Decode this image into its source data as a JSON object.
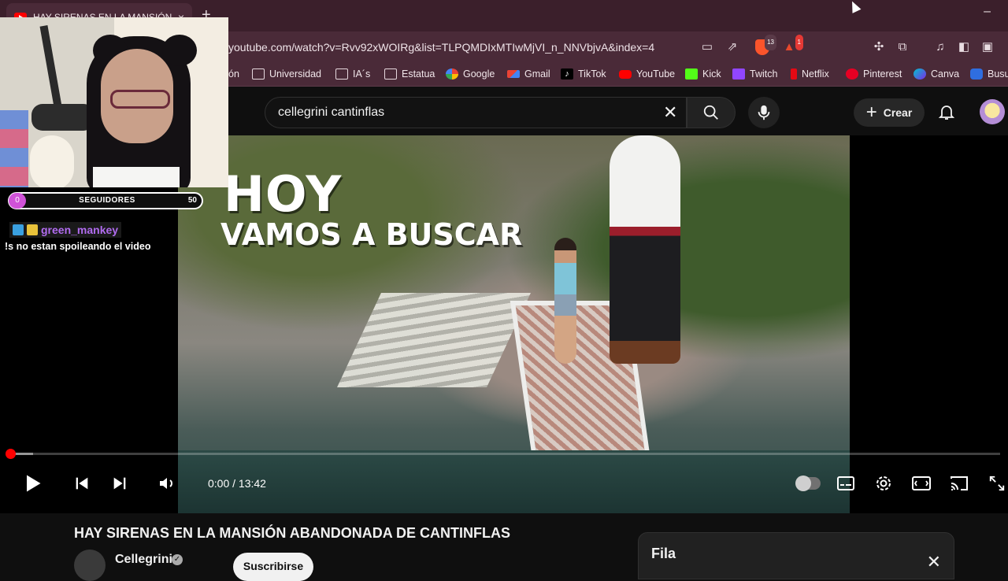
{
  "browser": {
    "tab_title": "HAY SIRENAS EN LA MANSIÓN /",
    "tab_close": "×",
    "new_tab": "+",
    "minimize": "–",
    "url": "youtube.com/watch?v=Rvv92xWOIRg&list=TLPQMDIxMTIwMjVI_n_NNVbjvA&index=4",
    "shield_badge": "13",
    "alert_badge": "1"
  },
  "bookmarks": [
    {
      "label": "ón",
      "icon": "folder-icon"
    },
    {
      "label": "Universidad",
      "icon": "folder-icon"
    },
    {
      "label": "IA´s",
      "icon": "folder-icon"
    },
    {
      "label": "Estatua",
      "icon": "folder-icon"
    },
    {
      "label": "Google",
      "icon": "google-icon"
    },
    {
      "label": "Gmail",
      "icon": "gmail-icon"
    },
    {
      "label": "TikTok",
      "icon": "tiktok-icon"
    },
    {
      "label": "YouTube",
      "icon": "youtube-icon"
    },
    {
      "label": "Kick",
      "icon": "kick-icon"
    },
    {
      "label": "Twitch",
      "icon": "twitch-icon"
    },
    {
      "label": "Netflix",
      "icon": "netflix-icon"
    },
    {
      "label": "Pinterest",
      "icon": "pinterest-icon"
    },
    {
      "label": "Canva",
      "icon": "canva-icon"
    },
    {
      "label": "Busu",
      "icon": "busuu-icon"
    }
  ],
  "youtube": {
    "search_query": "cellegrini cantinflas",
    "create_label": "Crear"
  },
  "player": {
    "overlay_line1": "HOY",
    "overlay_line2": "VAMOS A BUSCAR",
    "time": "0:00 / 13:42",
    "progress_fraction": 0.0,
    "buffered_fraction": 0.024
  },
  "video": {
    "title": "HAY SIRENAS EN LA MANSIÓN ABANDONADA DE CANTINFLAS",
    "channel": "Cellegrini",
    "subscribe_label": "Suscribirse",
    "verified_glyph": "✓"
  },
  "queue": {
    "label": "Fila",
    "close": "✕"
  },
  "stream_overlay": {
    "followers_current": "0",
    "followers_label": "SEGUIDORES",
    "followers_goal": "50",
    "chat_user": "green_mankey",
    "chat_message": "!s no estan spoileando el video"
  },
  "colors": {
    "youtube_red": "#ff0000",
    "browser_frame": "#4a2a38",
    "chat_username": "#b16cf0"
  }
}
